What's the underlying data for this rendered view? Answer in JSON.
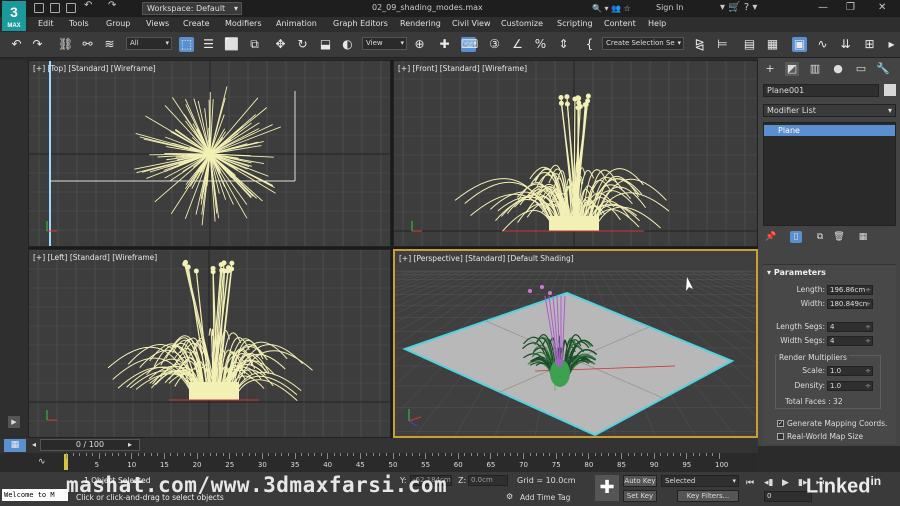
{
  "window": {
    "app_logo": "3",
    "app_logo_sub": "MAX",
    "workspace": "Workspace: Default",
    "file_title": "02_09_shading_modes.max",
    "sign_in": "Sign In"
  },
  "menu": [
    "Edit",
    "Tools",
    "Group",
    "Views",
    "Create",
    "Modifiers",
    "Animation",
    "Graph Editors",
    "Rendering",
    "Civil View",
    "Customize",
    "Scripting",
    "Content",
    "Help"
  ],
  "toolbar": {
    "filter": "All",
    "ref_coord": "View",
    "named_selection": "Create Selection Se"
  },
  "viewports": {
    "top": "[+] [Top] [Standard] [Wireframe]",
    "front": "[+] [Front] [Standard] [Wireframe]",
    "left": "[+] [Left] [Standard] [Wireframe]",
    "perspective": "[+] [Perspective] [Standard] [Default Shading]"
  },
  "command_panel": {
    "object_name": "Plane001",
    "modifier_list": "Modifier List",
    "stack_item": "Plane",
    "rollout": "Parameters",
    "length_label": "Length:",
    "length": "196.86cm",
    "width_label": "Width:",
    "width": "180.849cn",
    "length_segs_label": "Length Segs:",
    "length_segs": "4",
    "width_segs_label": "Width Segs:",
    "width_segs": "4",
    "render_multipliers": "Render Multipliers",
    "scale_label": "Scale:",
    "scale": "1.0",
    "density_label": "Density:",
    "density": "1.0",
    "total_faces": "Total Faces : 32",
    "gen_mapping": "Generate Mapping Coords.",
    "real_world": "Real-World Map Size"
  },
  "timeline": {
    "slider": "0 / 100",
    "ticks": [
      "5",
      "10",
      "15",
      "20",
      "25",
      "30",
      "35",
      "40",
      "45",
      "50",
      "55",
      "60",
      "65",
      "70",
      "75",
      "80",
      "85",
      "90",
      "95",
      "100"
    ]
  },
  "status": {
    "maxscript": "Welcome to M",
    "selection": "1 Object Selected",
    "prompt": "Click or click-and-drag to select objects",
    "y_label": "Y:",
    "y_value": "-62.184cm",
    "z_label": "Z:",
    "z_value": "0.0cm",
    "grid": "Grid = 10.0cm",
    "add_time_tag": "Add Time Tag",
    "auto_key": "Auto Key",
    "set_key": "Set Key",
    "selected": "Selected",
    "key_filters": "Key Filters...",
    "frame": "0"
  },
  "watermarks": {
    "url": "mashat.com/www.3dmaxfarsi.com",
    "brand": "Linked",
    "brand_suffix": "in"
  },
  "colors": {
    "accent": "#5a8fd0",
    "active_viewport": "#c8a032",
    "grass": "#f3f0b5",
    "plane_edge": "#4fd3e0",
    "app_teal": "#1a9a9a"
  }
}
